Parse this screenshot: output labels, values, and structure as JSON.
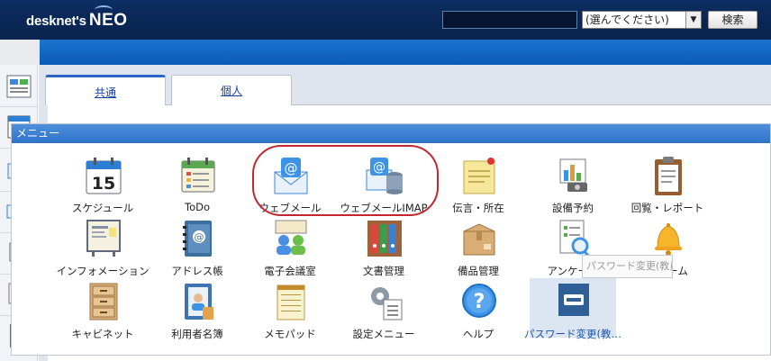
{
  "header": {
    "logo_small": "desknet's",
    "logo_big": "NEO",
    "search_placeholder": "",
    "scope_select": "(選んでください)",
    "search_button": "検索"
  },
  "tabs": [
    {
      "label": "共通",
      "active": true
    },
    {
      "label": "個人",
      "active": false
    }
  ],
  "menu": {
    "title": "メニュー",
    "items": [
      {
        "label": "スケジュール",
        "icon": "calendar-icon"
      },
      {
        "label": "ToDo",
        "icon": "todo-icon"
      },
      {
        "label": "ウェブメール",
        "icon": "webmail-icon"
      },
      {
        "label": "ウェブメールIMAP",
        "icon": "webmail-imap-icon"
      },
      {
        "label": "伝言・所在",
        "icon": "memo-note-icon"
      },
      {
        "label": "設備予約",
        "icon": "facility-icon"
      },
      {
        "label": "回覧・レポート",
        "icon": "clipboard-icon"
      },
      {
        "label": "インフォメーション",
        "icon": "info-board-icon"
      },
      {
        "label": "アドレス帳",
        "icon": "address-book-icon"
      },
      {
        "label": "電子会議室",
        "icon": "conference-icon"
      },
      {
        "label": "文書管理",
        "icon": "binders-icon"
      },
      {
        "label": "備品管理",
        "icon": "box-icon"
      },
      {
        "label": "アンケート",
        "icon": "survey-icon"
      },
      {
        "label": "アラーム",
        "icon": "bell-icon"
      },
      {
        "label": "キャビネット",
        "icon": "cabinet-icon"
      },
      {
        "label": "利用者名簿",
        "icon": "user-directory-icon"
      },
      {
        "label": "メモパッド",
        "icon": "notepad-icon"
      },
      {
        "label": "設定メニュー",
        "icon": "settings-icon"
      },
      {
        "label": "ヘルプ",
        "icon": "help-icon"
      },
      {
        "label": "パスワード変更(教…",
        "icon": "password-change-icon",
        "selected": true
      }
    ]
  },
  "tooltip": "パスワード変更(教員)",
  "sidebar_icons": [
    "portal-icon",
    "calendar-icon",
    "webmail-icon",
    "webmail-imap-icon",
    "facility-icon",
    "info-icon",
    "clipboard-icon"
  ],
  "colors": {
    "header": "#0a2654",
    "band": "#0f63c1",
    "menu_header": "#3a7dd0",
    "highlight_ring": "#c1272d"
  }
}
